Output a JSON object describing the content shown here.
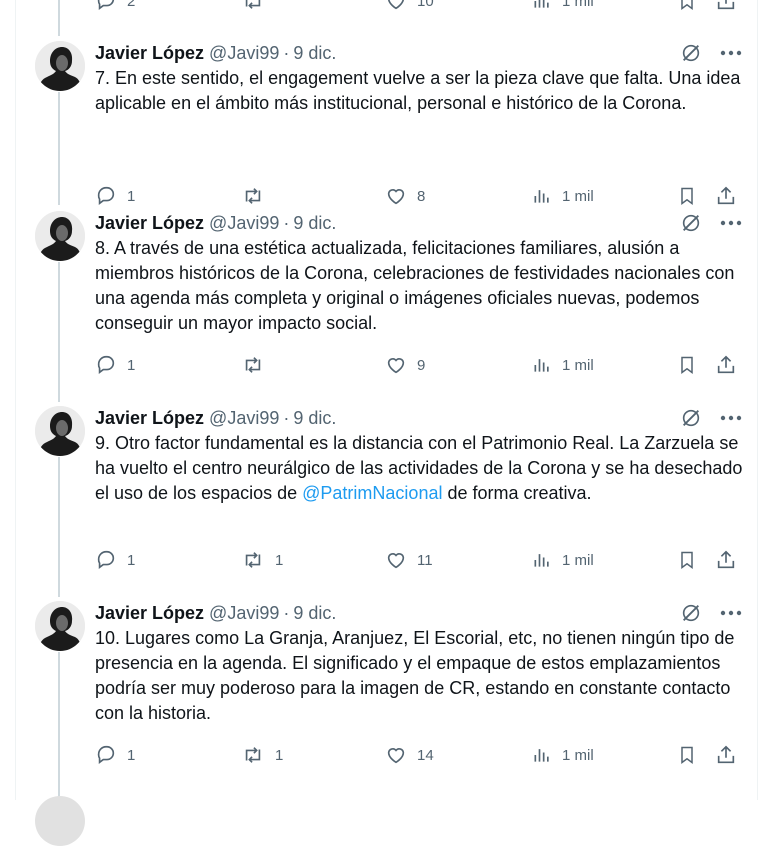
{
  "top_partial": {
    "reply_count": "2",
    "like_count": "10",
    "views": "1 mil"
  },
  "tweets": [
    {
      "name": "Javier López",
      "handle": "@Javi99",
      "date": "9 dic.",
      "text_before": "7. En este sentido, el engagement vuelve a ser la pieza clave que falta. Una idea aplicable en el ámbito más institucional, personal e histórico de la Corona.",
      "mention": "",
      "text_after": "",
      "replies": "1",
      "retweets": "",
      "likes": "8",
      "views": "1 mil"
    },
    {
      "name": "Javier López",
      "handle": "@Javi99",
      "date": "9 dic.",
      "text_before": "8. A través de una estética actualizada, felicitaciones familiares, alusión a miembros históricos de la Corona, celebraciones de festividades nacionales con una agenda más completa y original o imágenes oficiales nuevas, podemos conseguir un mayor impacto social.",
      "mention": "",
      "text_after": "",
      "replies": "1",
      "retweets": "",
      "likes": "9",
      "views": "1 mil"
    },
    {
      "name": "Javier López",
      "handle": "@Javi99",
      "date": "9 dic.",
      "text_before": "9. Otro factor fundamental es la distancia con el Patrimonio Real. La Zarzuela se ha vuelto el centro neurálgico de las actividades de la Corona y se ha desechado el uso de los espacios de ",
      "mention": "@PatrimNacional",
      "text_after": "  de forma creativa.",
      "replies": "1",
      "retweets": "1",
      "likes": "11",
      "views": "1 mil"
    },
    {
      "name": "Javier López",
      "handle": "@Javi99",
      "date": "9 dic.",
      "text_before": "10. Lugares como La Granja, Aranjuez, El Escorial, etc, no tienen ningún tipo de presencia en la agenda. El significado y el empaque de estos emplazamientos podría ser muy poderoso para la imagen de CR, estando en constante contacto con la historia.",
      "mention": "",
      "text_after": "",
      "replies": "1",
      "retweets": "1",
      "likes": "14",
      "views": "1 mil"
    }
  ],
  "icons": [
    "reply-icon",
    "retweet-icon",
    "like-icon",
    "views-icon",
    "bookmark-icon",
    "share-icon",
    "grok-icon",
    "more-icon"
  ],
  "colors": {
    "text": "#0f1419",
    "secondary": "#536471",
    "link": "#1d9bf0",
    "thread": "#cfd9de"
  }
}
